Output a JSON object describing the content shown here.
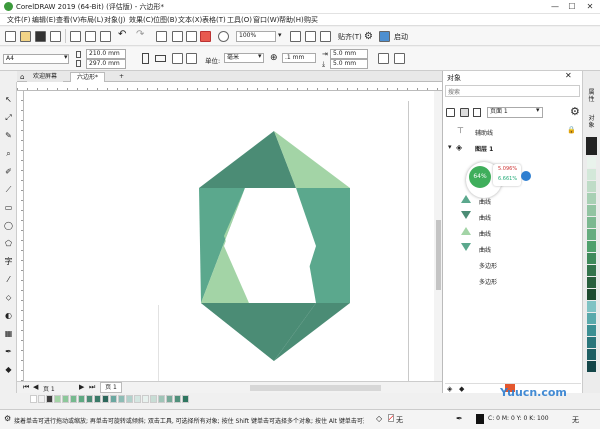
{
  "window": {
    "title": "CorelDRAW 2019 (64-Bit) (评估版) - 六边形*",
    "minimize": "—",
    "maximize": "☐",
    "close": "✕"
  },
  "menu": [
    "文件(F)",
    "编辑(E)",
    "查看(V)",
    "布局(L)",
    "对象(J)",
    "效果(C)",
    "位图(B)",
    "文本(X)",
    "表格(T)",
    "工具(O)",
    "窗口(W)",
    "帮助(H)",
    "购买"
  ],
  "toolbar1": {
    "zoom_value": "100%",
    "snap_label": "贴齐(T)",
    "launch_label": "启动"
  },
  "toolbar2": {
    "paper_size": "A4",
    "width": "210.0 mm",
    "height": "297.0 mm",
    "units_label": "单位:",
    "units_value": "毫米",
    "nudge": ".1 mm",
    "dup_x": "5.0 mm",
    "dup_y": "5.0 mm"
  },
  "doc_tabs": {
    "welcome": "欢迎屏幕",
    "document": "六边形*",
    "add": "+"
  },
  "tools": [
    "↖",
    "⤢",
    "✎",
    "⌕",
    "✐",
    "⟋",
    "▭",
    "◯",
    "⬠",
    "字",
    "⁄",
    "⬦",
    "◐",
    "▦",
    "✒",
    "◆"
  ],
  "colors": {
    "accent": "#2f7fd0",
    "hex_dark": "#4b8c75",
    "hex_mid": "#5ba88d",
    "hex_light": "#a3d4a6",
    "canvas_bg": "#ffffff"
  },
  "page_nav": {
    "page_label": "页 1"
  },
  "docker": {
    "title": "对象",
    "search_placeholder": "搜索",
    "page_select": "页面 1",
    "guides_label": "辅助线",
    "layer_label": "图层 1",
    "badge_percent": "64%",
    "badge_line1": "5.096%",
    "badge_line2": "6.661%",
    "items": [
      "曲线",
      "曲线",
      "曲线",
      "曲线",
      "曲线",
      "多边形",
      "多边形"
    ]
  },
  "right_tabs": [
    "属性",
    "对象"
  ],
  "status": {
    "hint": "接着单击可进行拖动或缩放; 再单击可旋转或倾斜; 双击工具, 可选择所有对象; 按住 Shift 键单击可选择多个对象; 按住 Alt 键单击可进行挖掘",
    "fill_none": "无",
    "cmyk": "C: 0 M: 0 Y: 0 K: 100",
    "outline_none": "无"
  },
  "watermark": "Yuucn.com"
}
